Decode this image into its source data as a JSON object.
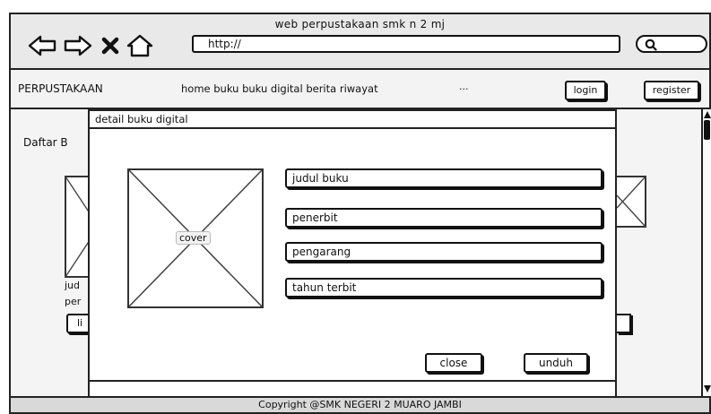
{
  "window": {
    "title": "web perpustakaan smk n 2 mj"
  },
  "browser": {
    "url": "http://",
    "nav_icons": [
      "back-arrow-icon",
      "forward-arrow-icon",
      "close-icon",
      "home-icon"
    ],
    "search_icon": "search-icon"
  },
  "navbar": {
    "brand": "PERPUSTAKAAN",
    "menu": "home buku buku digital berita riwayat",
    "ellipsis": "...",
    "login": "login",
    "register": "register"
  },
  "background_page": {
    "heading_fragment": "Daftar B",
    "fragments": [
      "jud",
      "per",
      "li"
    ]
  },
  "modal": {
    "title": "detail buku digital",
    "cover_label": "cover",
    "fields": {
      "judul": "judul buku",
      "penerbit": "penerbit",
      "pengarang": "pengarang",
      "tahun": "tahun terbit"
    },
    "close_label": "close",
    "download_label": "unduh"
  },
  "footer": {
    "copyright": "Copyright @SMK NEGERI 2 MUARO JAMBI"
  }
}
